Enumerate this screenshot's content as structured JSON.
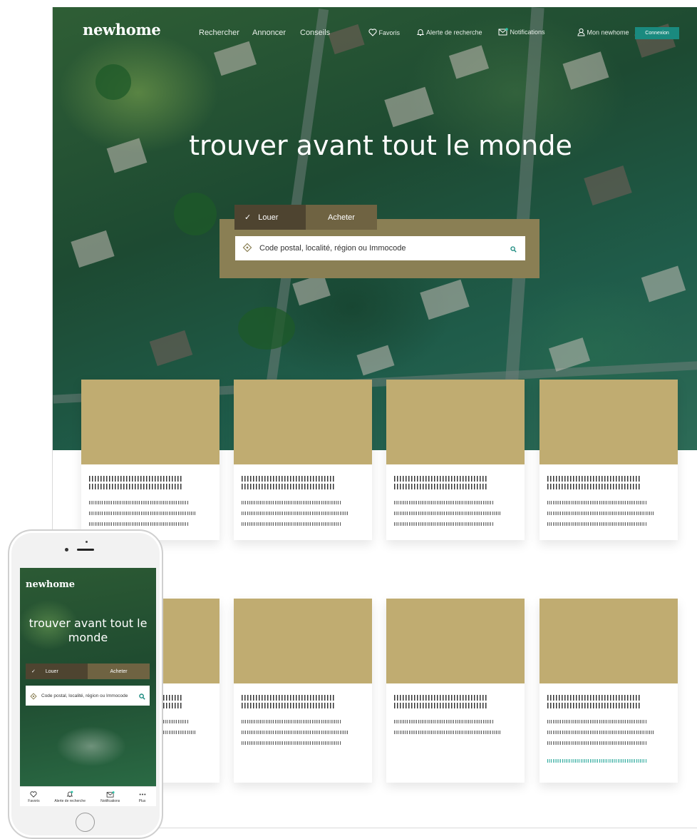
{
  "desktop": {
    "logo": "newhome",
    "nav": {
      "rechercher": "Rechercher",
      "annoncer": "Annoncer",
      "conseils": "Conseils",
      "favoris": "Favoris",
      "alerte": "Alerte de recherche",
      "notifications": "Notifications",
      "mon_newhome": "Mon newhome",
      "connexion": "Connexion"
    },
    "hero_title": "trouver avant tout le monde",
    "tabs": {
      "louer": "Louer",
      "acheter": "Acheter",
      "check": "✓"
    },
    "search_placeholder": "Code postal, localité, région ou Immocode"
  },
  "mobile": {
    "logo": "newhome",
    "hero_title": "trouver avant tout le monde",
    "tabs": {
      "louer": "Louer",
      "acheter": "Acheter",
      "check": "✓"
    },
    "search_placeholder": "Code postal, localité, région ou Immocode",
    "tabbar": {
      "favoris": "Favoris",
      "alerte": "Alerte de recherche",
      "notifications": "Notifications",
      "plus": "Plus"
    }
  },
  "colors": {
    "accent_teal": "#1a8a7f",
    "card_image": "#c0ac71",
    "tab_active": "#4e4430",
    "tab_inactive": "#6f6342",
    "search_panel": "#8a7f54"
  }
}
